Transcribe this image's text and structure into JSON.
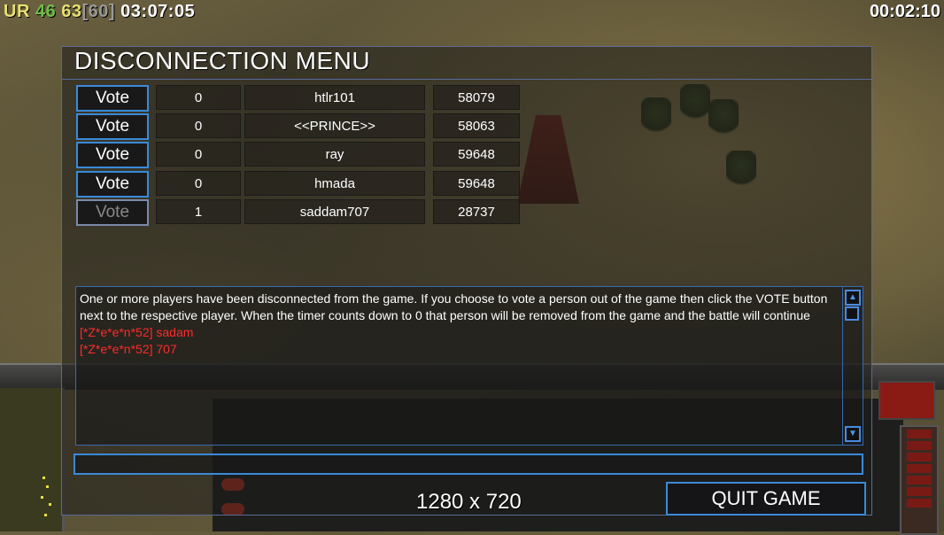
{
  "hud": {
    "left_ur": "UR",
    "left_n1": "46",
    "left_n2": "63",
    "left_n3": "[60]",
    "left_clock": "03:07:05",
    "right_clock": "00:02:10"
  },
  "dialog": {
    "title": "DISCONNECTION MENU",
    "players": [
      {
        "vote_label": "Vote",
        "vote_enabled": true,
        "count": "0",
        "name": "htlr101",
        "id": "58079"
      },
      {
        "vote_label": "Vote",
        "vote_enabled": true,
        "count": "0",
        "name": "<<PRINCE>>",
        "id": "58063"
      },
      {
        "vote_label": "Vote",
        "vote_enabled": true,
        "count": "0",
        "name": "ray",
        "id": "59648"
      },
      {
        "vote_label": "Vote",
        "vote_enabled": true,
        "count": "0",
        "name": "hmada",
        "id": "59648"
      },
      {
        "vote_label": "Vote",
        "vote_enabled": false,
        "count": "1",
        "name": "saddam707",
        "id": "28737"
      }
    ],
    "chat": {
      "message": "One or more players have been disconnected from the game. If you choose to vote a person out of the game then click the VOTE button next to the respective player. When the timer counts down to 0 that person will be removed from the game and the battle will continue",
      "lines": [
        "[*Z*e*e*n*52] sadam",
        "[*Z*e*e*n*52] 707"
      ]
    },
    "input": {
      "value": ""
    },
    "resolution": "1280 x 720",
    "quit_label": "QUIT GAME"
  },
  "colors": {
    "accent": "#3a8ad8",
    "chat_red": "#ff2a2a",
    "ur_yellow": "#e8e070",
    "green": "#6fbf4a"
  },
  "icons": [
    "scroll-up-arrow-icon",
    "scroll-down-arrow-icon"
  ]
}
